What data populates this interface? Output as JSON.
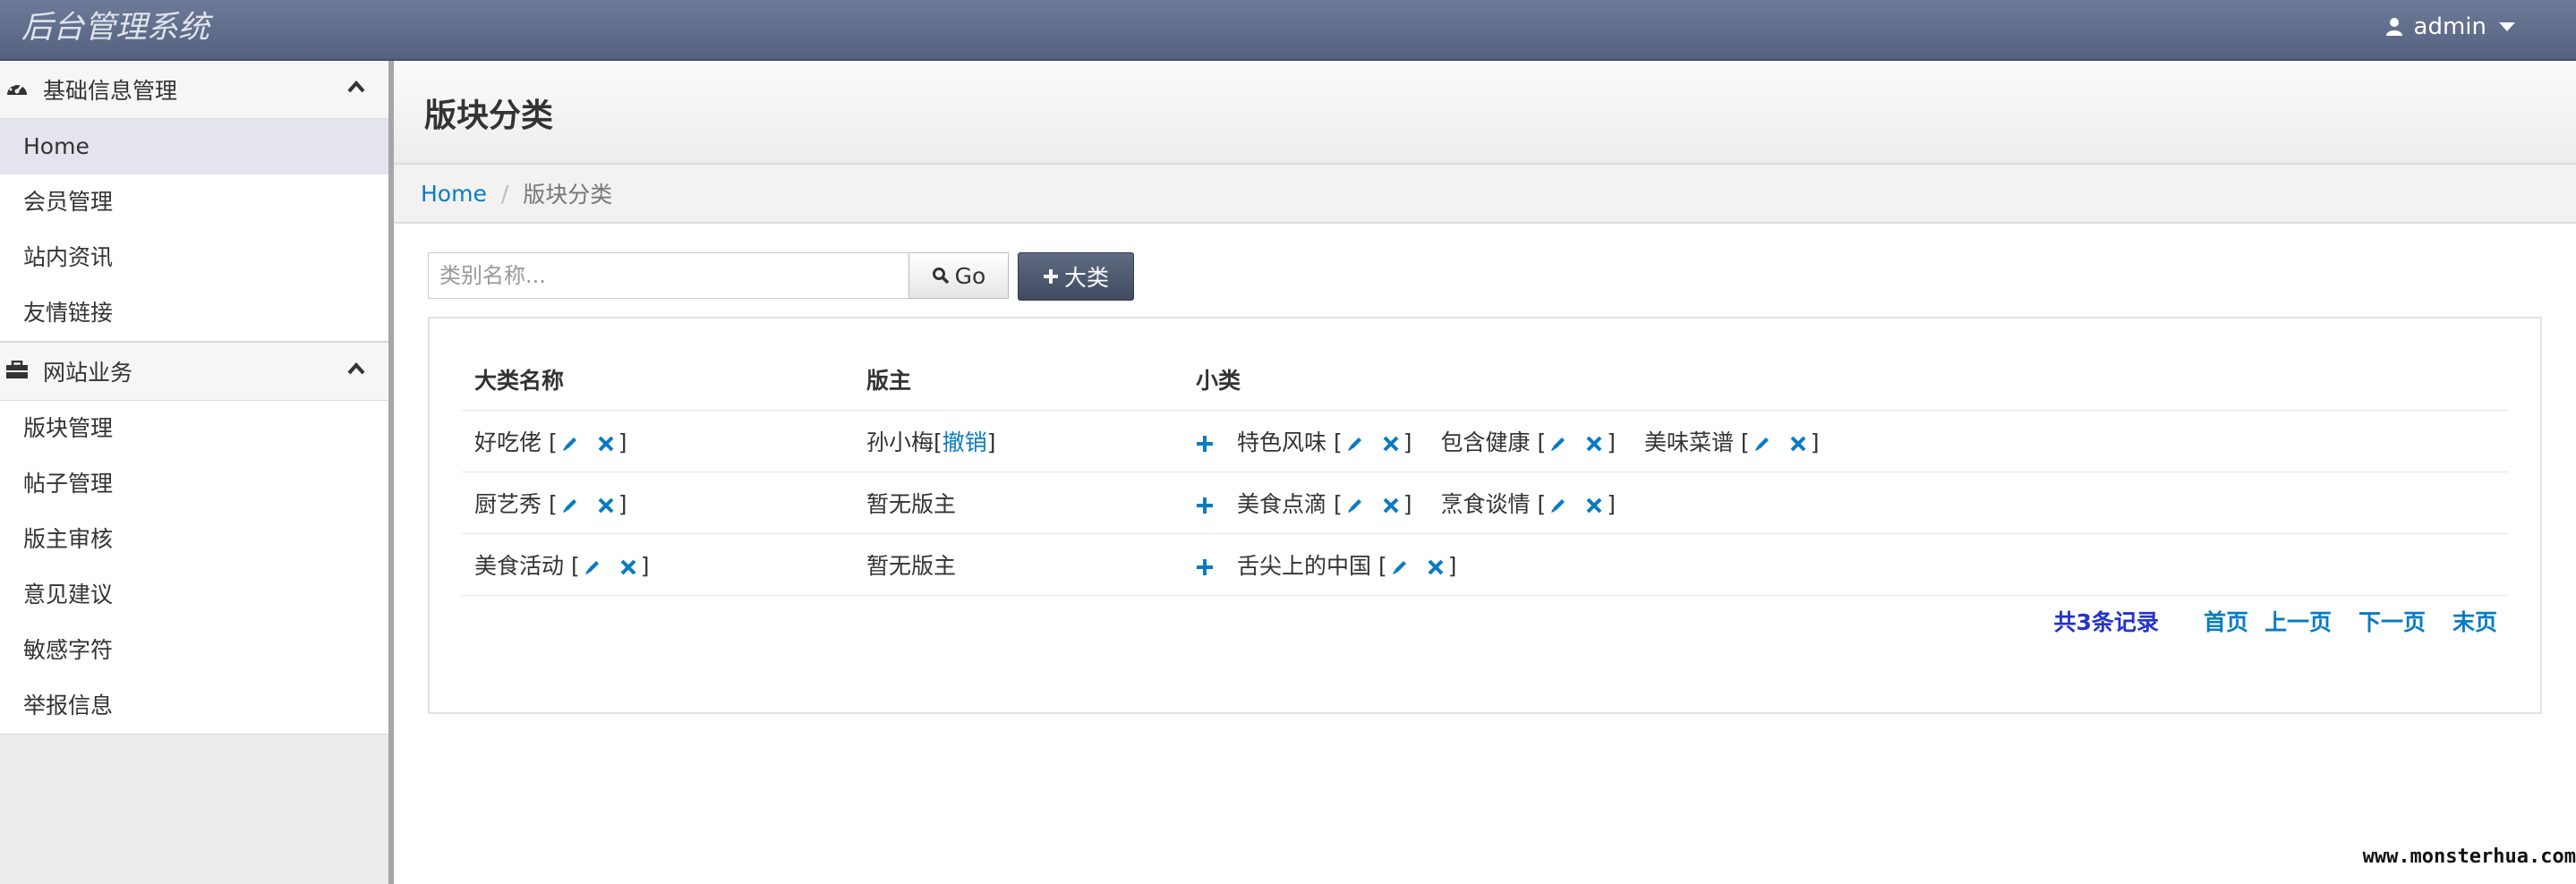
{
  "app": {
    "title": "后台管理系统",
    "user": "admin"
  },
  "sidebar": {
    "sections": [
      {
        "label": "基础信息管理",
        "icon": "dashboard-icon",
        "items": [
          "Home",
          "会员管理",
          "站内资讯",
          "友情链接"
        ]
      },
      {
        "label": "网站业务",
        "icon": "briefcase-icon",
        "items": [
          "版块管理",
          "帖子管理",
          "版主审核",
          "意见建议",
          "敏感字符",
          "举报信息"
        ]
      }
    ],
    "active": "Home"
  },
  "page": {
    "title": "版块分类"
  },
  "breadcrumb": {
    "home": "Home",
    "current": "版块分类"
  },
  "toolbar": {
    "search_placeholder": "类别名称...",
    "go_label": "Go",
    "add_label": "大类"
  },
  "table": {
    "headers": [
      "大类名称",
      "版主",
      "小类"
    ],
    "rows": [
      {
        "name": "好吃佬",
        "moderator": "孙小梅",
        "revoke": "撤销",
        "subs": [
          "特色风味",
          "包含健康",
          "美味菜谱"
        ]
      },
      {
        "name": "厨艺秀",
        "moderator": "暂无版主",
        "subs": [
          "美食点滴",
          "烹食谈情"
        ]
      },
      {
        "name": "美食活动",
        "moderator": "暂无版主",
        "subs": [
          "舌尖上的中国"
        ]
      }
    ]
  },
  "pager": {
    "total": "共3条记录",
    "first": "首页",
    "prev": "上一页",
    "next": "下一页",
    "last": "末页"
  },
  "watermark": "www.monsterhua.com",
  "colors": {
    "navbar": "#5f6b89",
    "link": "#0a7bc2",
    "add_button": "#4a5468",
    "total_text": "#2233cc"
  }
}
